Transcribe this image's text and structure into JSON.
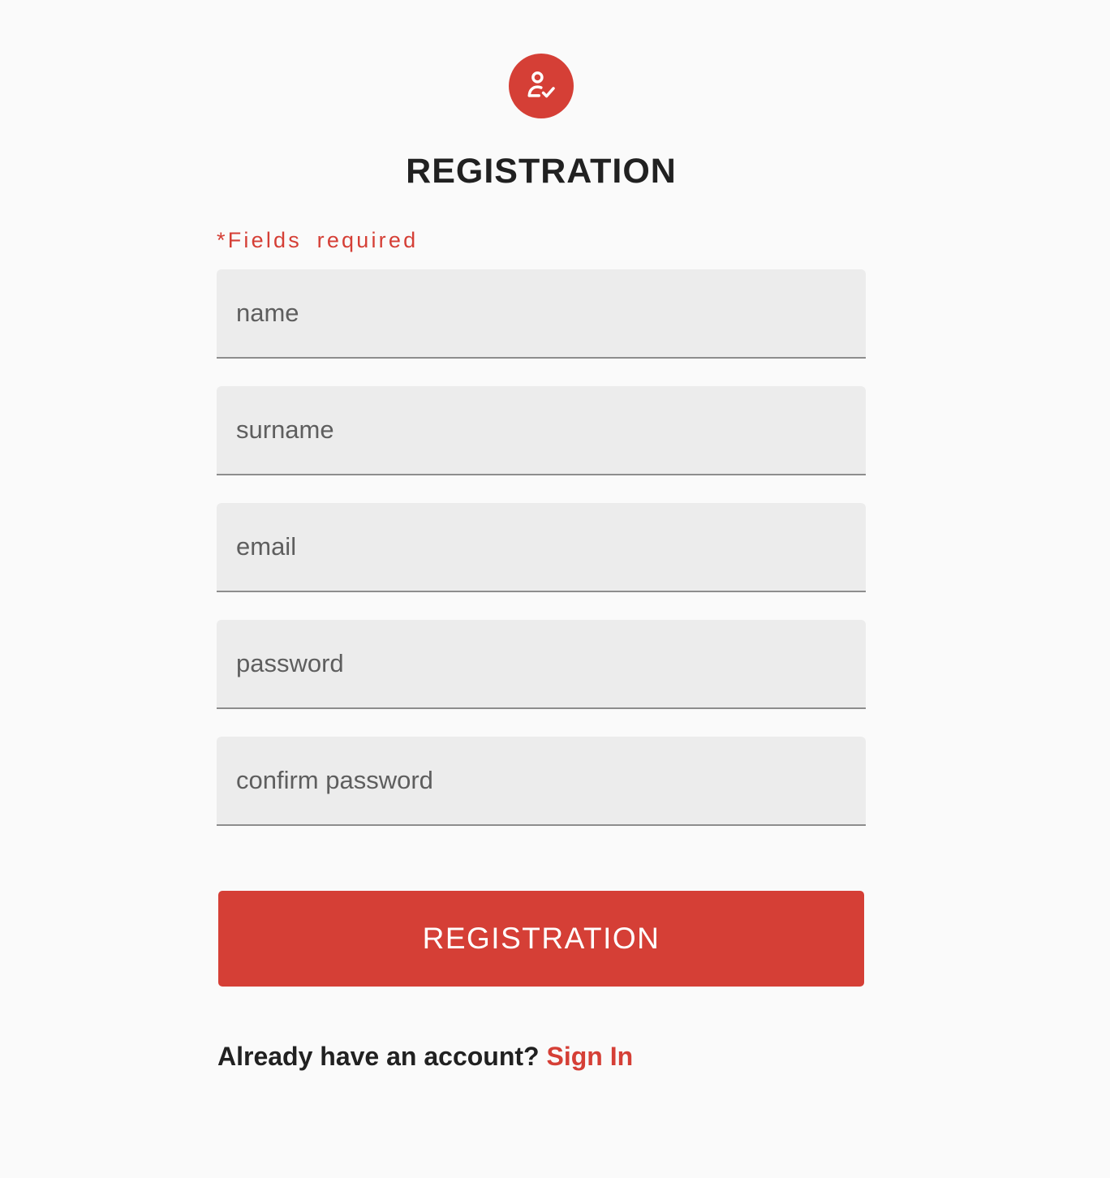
{
  "colors": {
    "accent": "#d53f36",
    "background": "#fafafa",
    "field_background": "#ececec",
    "text": "#212121"
  },
  "header": {
    "icon": "user-check-icon",
    "title": "REGISTRATION"
  },
  "form": {
    "required_note": "*Fields required",
    "fields": {
      "name": {
        "placeholder": "name",
        "value": ""
      },
      "surname": {
        "placeholder": "surname",
        "value": ""
      },
      "email": {
        "placeholder": "email",
        "value": ""
      },
      "password": {
        "placeholder": "password",
        "value": ""
      },
      "confirm_password": {
        "placeholder": "confirm password",
        "value": ""
      }
    },
    "submit_label": "REGISTRATION"
  },
  "footer": {
    "prompt": "Already have an account?",
    "link_label": "Sign In"
  }
}
